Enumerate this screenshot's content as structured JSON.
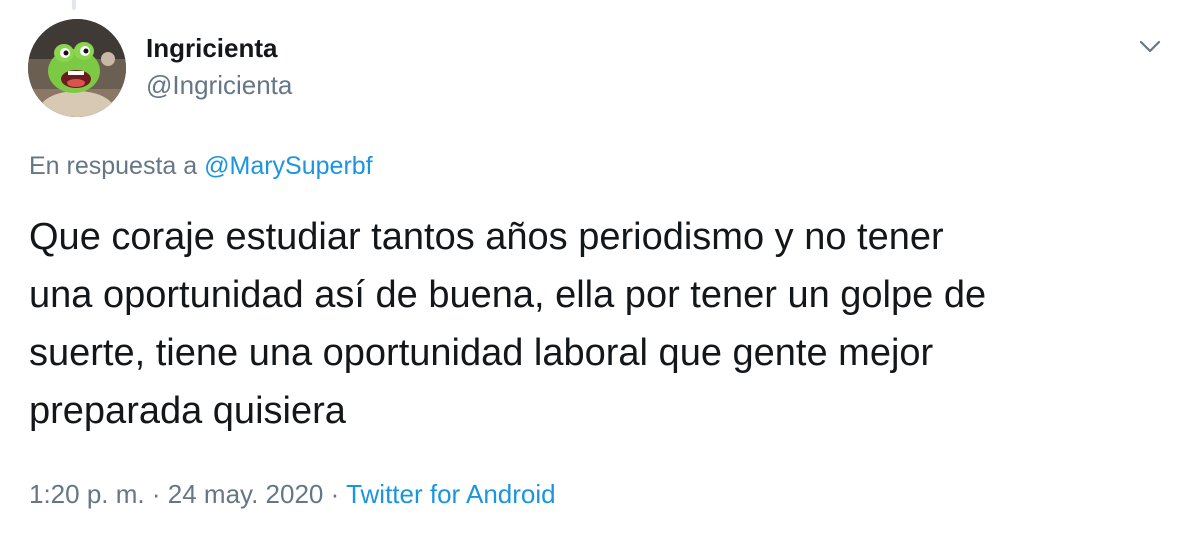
{
  "tweet": {
    "author": {
      "display_name": "Ingricienta",
      "handle": "@Ingricienta",
      "avatar": "cartoon-character-avatar"
    },
    "reply": {
      "prefix": "En respuesta a",
      "mention": "@MarySuperbf"
    },
    "text": "Que coraje estudiar tantos años periodismo y no tener\nuna oportunidad así de buena, ella por tener un golpe de\nsuerte, tiene una oportunidad laboral que gente mejor\npreparada quisiera",
    "time": "1:20 p. m.",
    "separator": "·",
    "date": "24 may. 2020",
    "source": "Twitter for Android",
    "menu_icon": "chevron-down-icon"
  },
  "colors": {
    "text": "#14171a",
    "secondary": "#657786",
    "link": "#1b95e0",
    "divider": "#e1e8ed"
  }
}
